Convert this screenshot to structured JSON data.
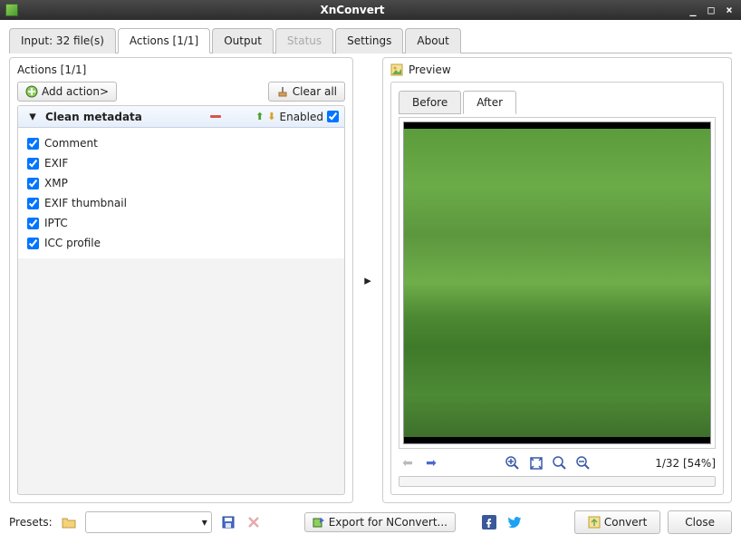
{
  "window": {
    "title": "XnConvert"
  },
  "tabs": {
    "input": "Input: 32 file(s)",
    "actions": "Actions [1/1]",
    "output": "Output",
    "status": "Status",
    "settings": "Settings",
    "about": "About"
  },
  "actions_panel": {
    "title": "Actions [1/1]",
    "add_action": "Add action>",
    "clear_all": "Clear all",
    "action_name": "Clean metadata",
    "enabled_label": "Enabled",
    "enabled": true,
    "options": [
      {
        "label": "Comment",
        "checked": true
      },
      {
        "label": "EXIF",
        "checked": true
      },
      {
        "label": "XMP",
        "checked": true
      },
      {
        "label": "EXIF thumbnail",
        "checked": true
      },
      {
        "label": "IPTC",
        "checked": true
      },
      {
        "label": "ICC profile",
        "checked": true
      }
    ]
  },
  "preview": {
    "title": "Preview",
    "before": "Before",
    "after": "After",
    "status": "1/32 [54%]"
  },
  "footer": {
    "presets_label": "Presets:",
    "export_label": "Export for NConvert...",
    "convert": "Convert",
    "close": "Close"
  }
}
